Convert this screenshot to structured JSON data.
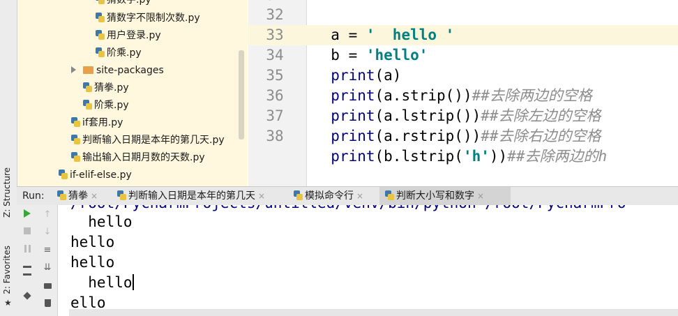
{
  "left_strip": {
    "structure_label": "Z: Structure",
    "favorites_label": "2: Favorites"
  },
  "project_tree": {
    "items": [
      {
        "label": "猜数字.py",
        "type": "file"
      },
      {
        "label": "猜数字不限制次数.py",
        "type": "file"
      },
      {
        "label": "用户登录.py",
        "type": "file"
      },
      {
        "label": "阶乘.py",
        "type": "file"
      },
      {
        "label": "site-packages",
        "type": "folder"
      },
      {
        "label": "猜拳.py",
        "type": "file"
      },
      {
        "label": "阶乘.py",
        "type": "file"
      },
      {
        "label": "if套用.py",
        "type": "file"
      },
      {
        "label": "判断输入日期是本年的第几天.py",
        "type": "file"
      },
      {
        "label": "输出输入日期月数的天数.py",
        "type": "file"
      },
      {
        "label": "if-elif-else.py",
        "type": "file"
      }
    ]
  },
  "editor": {
    "top_partial_line_number": "31",
    "lines": [
      {
        "num": "32",
        "parts": [
          [
            "plain",
            "a = "
          ],
          [
            "str",
            "'  hello '"
          ]
        ]
      },
      {
        "num": "33",
        "parts": [
          [
            "plain",
            "b = "
          ],
          [
            "str",
            "'hello'"
          ]
        ]
      },
      {
        "num": "34",
        "parts": [
          [
            "kw",
            "print"
          ],
          [
            "plain",
            "(a)"
          ]
        ]
      },
      {
        "num": "35",
        "parts": [
          [
            "kw",
            "print"
          ],
          [
            "plain",
            "(a.strip())"
          ],
          [
            "cmt",
            "##去除两边的空格"
          ]
        ]
      },
      {
        "num": "36",
        "parts": [
          [
            "kw",
            "print"
          ],
          [
            "plain",
            "(a.lstrip())"
          ],
          [
            "cmt",
            "##去除左边的空格"
          ]
        ]
      },
      {
        "num": "37",
        "parts": [
          [
            "kw",
            "print"
          ],
          [
            "plain",
            "(a.rstrip())"
          ],
          [
            "cmt",
            "##去除右边的空格"
          ]
        ]
      },
      {
        "num": "38",
        "parts": [
          [
            "kw",
            "print"
          ],
          [
            "plain",
            "(b.lstrip("
          ],
          [
            "str",
            "'h'"
          ],
          [
            "plain",
            "))"
          ],
          [
            "cmt",
            "##去除两边的h"
          ]
        ]
      }
    ]
  },
  "run_panel": {
    "label": "Run:",
    "tabs": [
      {
        "label": "猜拳",
        "close": "×",
        "active": false
      },
      {
        "label": "判断输入日期是本年的第几天",
        "close": "×",
        "active": false
      },
      {
        "label": "模拟命令行",
        "close": "×",
        "active": false
      },
      {
        "label": "判断大小写和数字",
        "close": "×",
        "active": true
      }
    ]
  },
  "console": {
    "command_partial": "/root/PycharmProjects/untitled/venv/bin/python /root/PycharmPro",
    "output_lines": [
      "  hello ",
      "hello",
      "hello",
      "  hello",
      "ello"
    ]
  },
  "colors": {
    "tree_bg": "#fff8df",
    "keyword": "#000080",
    "string": "#008080",
    "comment": "#8c8c8c",
    "run_green": "#3aa53a"
  }
}
